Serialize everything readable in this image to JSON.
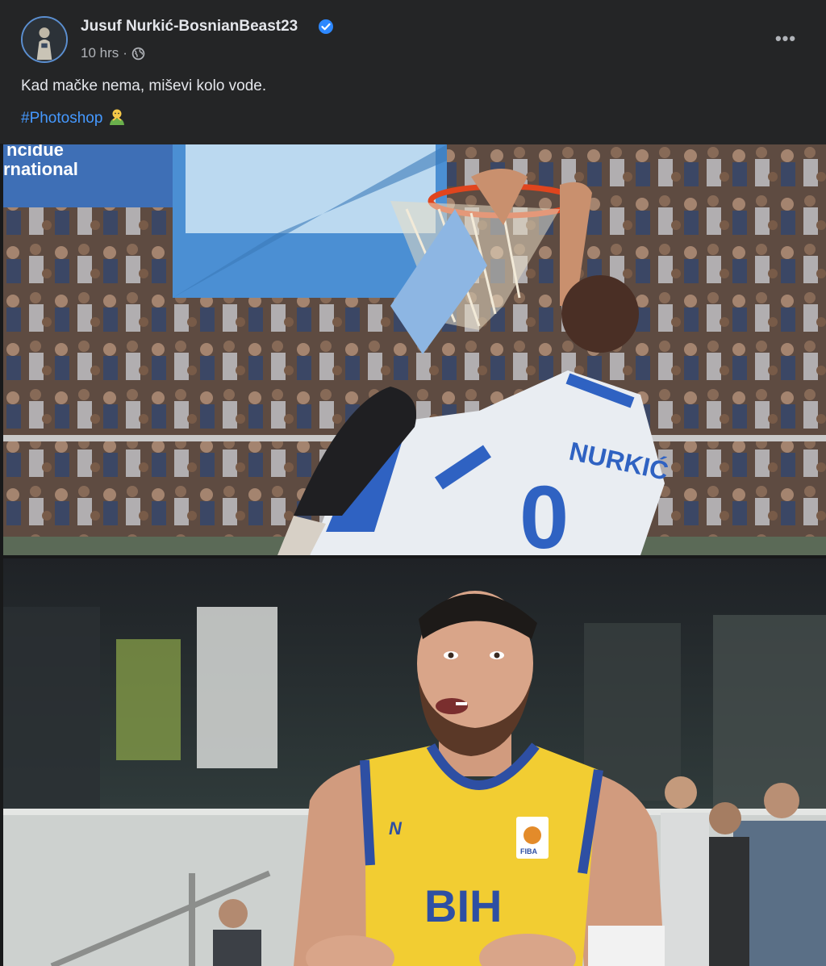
{
  "post": {
    "author_name": "Jusuf Nurkić-BosnianBeast23",
    "timestamp": "10 hrs",
    "separator": "·",
    "text": "Kad mačke nema, miševi kolo vode.",
    "hashtag": "#Photoshop",
    "more_label": "•••"
  },
  "photo1": {
    "banner_text_1": "ncidue",
    "banner_text_2": "rnational",
    "jersey_name": "NURKIĆ",
    "jersey_number": "0"
  },
  "photo2": {
    "jersey_text": "BIH",
    "brand_text": "N",
    "patch_text": "FIBA"
  },
  "colors": {
    "background": "#242526",
    "hashtag": "#4599ff",
    "verified": "#2d88ff",
    "jersey_yellow": "#f2cd32",
    "jersey_blue": "#2e4fa3"
  },
  "icons": [
    "verified-badge-icon",
    "globe-icon",
    "more-options-icon",
    "emoji-icon"
  ]
}
